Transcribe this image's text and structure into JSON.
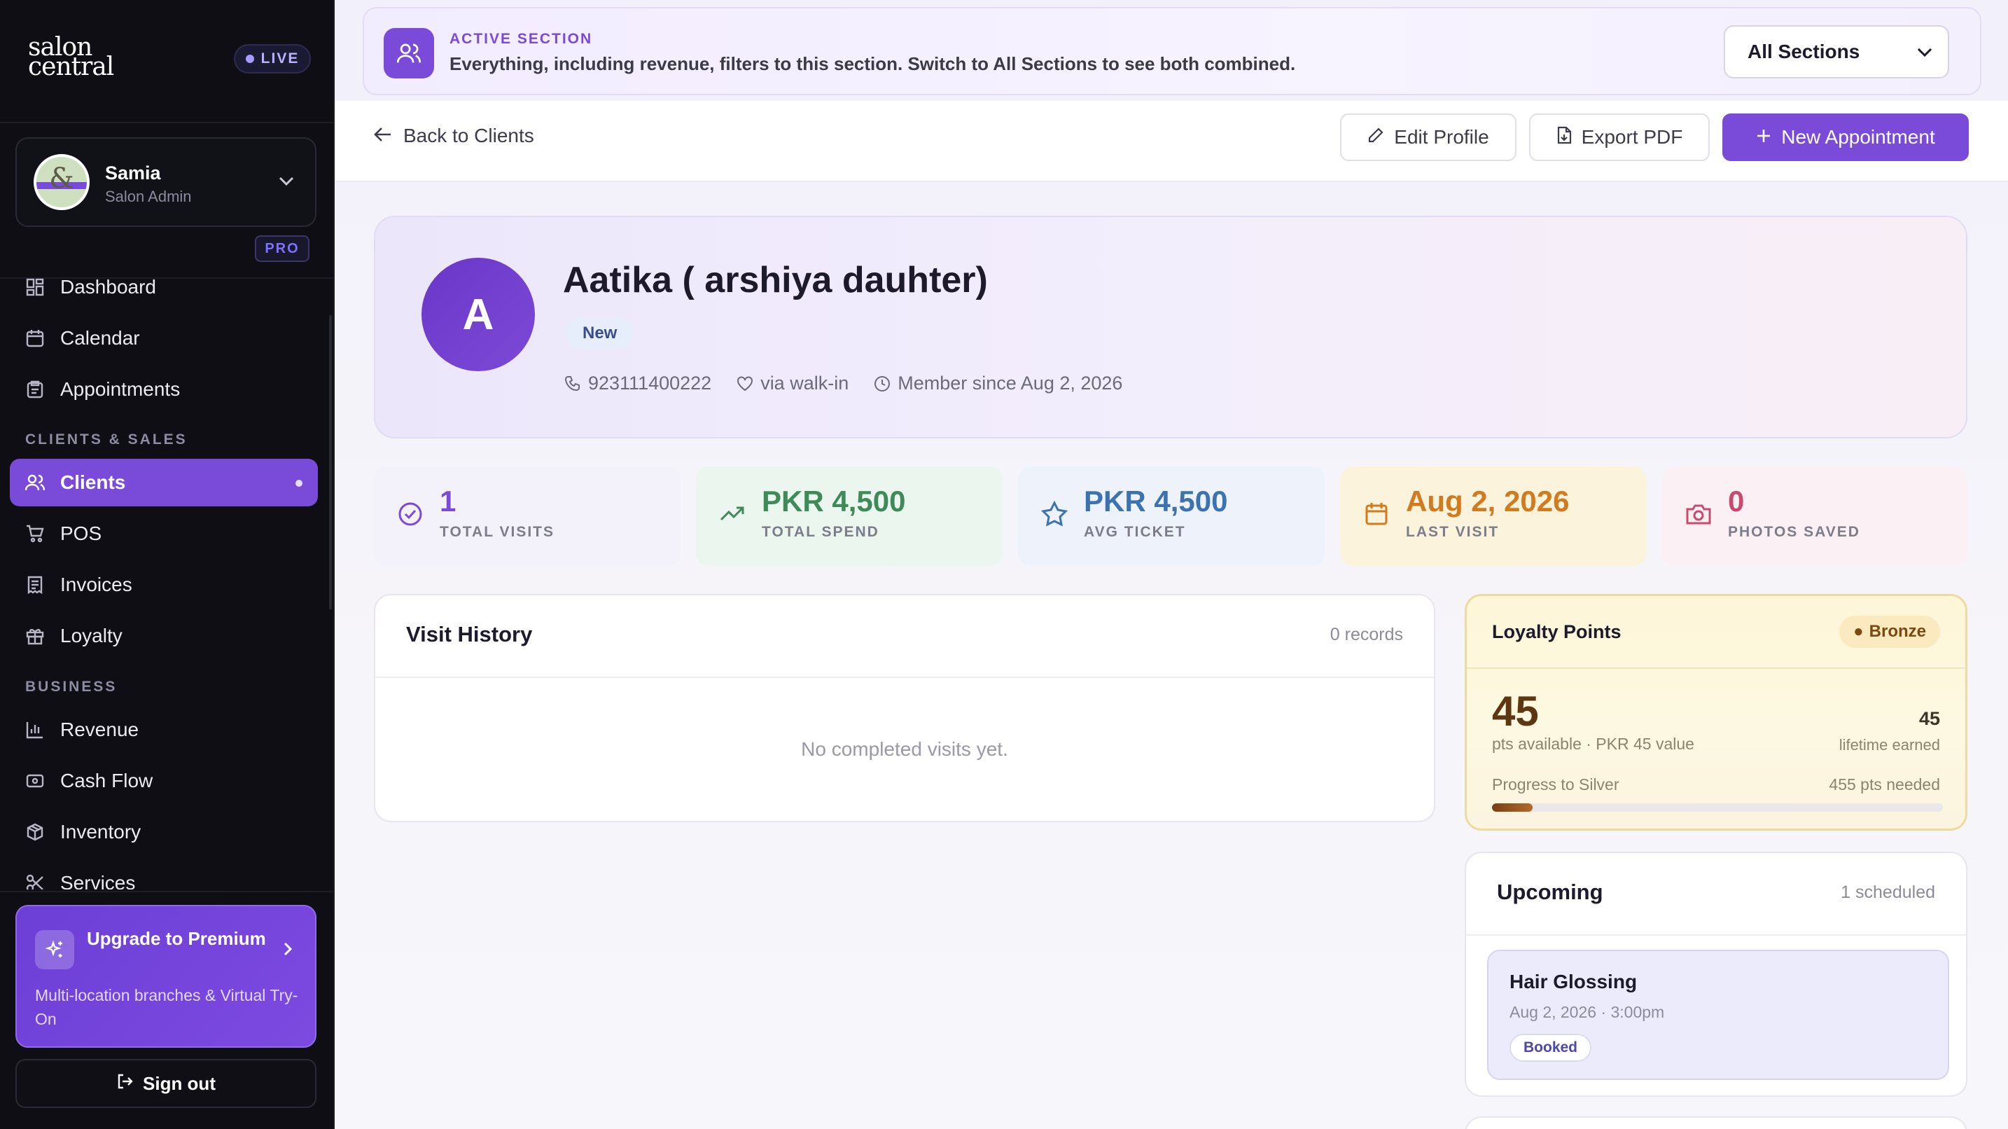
{
  "sidebar": {
    "logo": "salon central",
    "live": "LIVE",
    "user": {
      "name": "Samia",
      "role": "Salon Admin"
    },
    "pro": "PRO",
    "items": [
      {
        "label": "Dashboard",
        "icon": "dashboard-icon"
      },
      {
        "label": "Calendar",
        "icon": "calendar-icon"
      },
      {
        "label": "Appointments",
        "icon": "clipboard-icon"
      },
      {
        "label": "Clients",
        "icon": "users-icon",
        "active": true
      },
      {
        "label": "POS",
        "icon": "cart-icon"
      },
      {
        "label": "Invoices",
        "icon": "receipt-icon"
      },
      {
        "label": "Loyalty",
        "icon": "gift-icon"
      },
      {
        "label": "Revenue",
        "icon": "bar-chart-icon"
      },
      {
        "label": "Cash Flow",
        "icon": "wallet-icon"
      },
      {
        "label": "Inventory",
        "icon": "box-icon"
      },
      {
        "label": "Services",
        "icon": "scissors-icon"
      }
    ],
    "sections": {
      "clients_sales": "CLIENTS & SALES",
      "business": "BUSINESS"
    },
    "upgrade": {
      "title": "Upgrade to Premium",
      "desc": "Multi-location branches & Virtual Try-On"
    },
    "signout": "Sign out"
  },
  "banner": {
    "heading": "ACTIVE SECTION",
    "text": "Everything, including revenue, filters to this section. Switch to All Sections to see both combined.",
    "select_value": "All Sections"
  },
  "toolbar": {
    "back": "Back to Clients",
    "edit": "Edit Profile",
    "export": "Export PDF",
    "new": "New Appointment"
  },
  "profile": {
    "initial": "A",
    "name": "Aatika ( arshiya dauhter)",
    "tag": "New",
    "phone": "923111400222",
    "source": "via walk-in",
    "member_since": "Member since Aug 2, 2026"
  },
  "stats": [
    {
      "value": "1",
      "label": "TOTAL VISITS",
      "color": "#7a4bd8"
    },
    {
      "value": "PKR 4,500",
      "label": "TOTAL SPEND",
      "color": "#3e8a58"
    },
    {
      "value": "PKR 4,500",
      "label": "AVG TICKET",
      "color": "#3b73b0"
    },
    {
      "value": "Aug 2, 2026",
      "label": "LAST VISIT",
      "color": "#d27a1e"
    },
    {
      "value": "0",
      "label": "PHOTOS SAVED",
      "color": "#c84a6e"
    }
  ],
  "visit_history": {
    "title": "Visit History",
    "count": "0 records",
    "empty": "No completed visits yet."
  },
  "loyalty": {
    "title": "Loyalty Points",
    "tier": "Bronze",
    "points": "45",
    "sub": "pts available · PKR 45 value",
    "lifetime": "45",
    "lifetime_label": "lifetime earned",
    "progress_label": "Progress to Silver",
    "needed": "455 pts needed",
    "progress": 0.09
  },
  "upcoming": {
    "title": "Upcoming",
    "count": "1 scheduled",
    "appt": {
      "service": "Hair Glossing",
      "when": "Aug 2, 2026 · 3:00pm",
      "status": "Booked"
    }
  }
}
